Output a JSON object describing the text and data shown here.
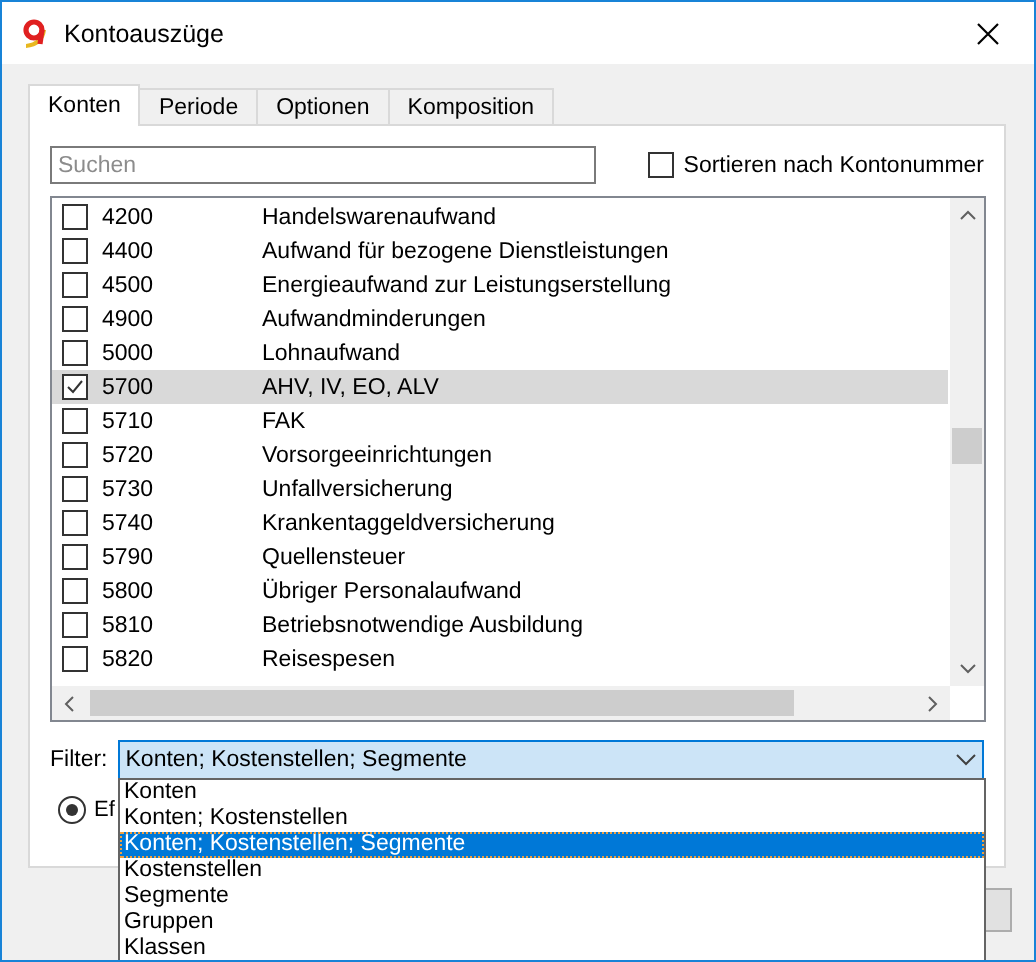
{
  "window": {
    "title": "Kontoauszüge"
  },
  "tabs": [
    {
      "label": "Konten",
      "selected": true
    },
    {
      "label": "Periode",
      "selected": false
    },
    {
      "label": "Optionen",
      "selected": false
    },
    {
      "label": "Komposition",
      "selected": false
    }
  ],
  "search": {
    "placeholder": "Suchen"
  },
  "sort_checkbox": {
    "label": "Sortieren nach Kontonummer",
    "checked": false
  },
  "accounts": [
    {
      "number": "4200",
      "name": "Handelswarenaufwand",
      "checked": false,
      "selected": false
    },
    {
      "number": "4400",
      "name": "Aufwand für bezogene Dienstleistungen",
      "checked": false,
      "selected": false
    },
    {
      "number": "4500",
      "name": "Energieaufwand zur Leistungserstellung",
      "checked": false,
      "selected": false
    },
    {
      "number": "4900",
      "name": "Aufwandminderungen",
      "checked": false,
      "selected": false
    },
    {
      "number": "5000",
      "name": "Lohnaufwand",
      "checked": false,
      "selected": false
    },
    {
      "number": "5700",
      "name": "AHV, IV, EO, ALV",
      "checked": true,
      "selected": true
    },
    {
      "number": "5710",
      "name": "FAK",
      "checked": false,
      "selected": false
    },
    {
      "number": "5720",
      "name": "Vorsorgeeinrichtungen",
      "checked": false,
      "selected": false
    },
    {
      "number": "5730",
      "name": "Unfallversicherung",
      "checked": false,
      "selected": false
    },
    {
      "number": "5740",
      "name": "Krankentaggeldversicherung",
      "checked": false,
      "selected": false
    },
    {
      "number": "5790",
      "name": "Quellensteuer",
      "checked": false,
      "selected": false
    },
    {
      "number": "5800",
      "name": "Übriger Personalaufwand",
      "checked": false,
      "selected": false
    },
    {
      "number": "5810",
      "name": "Betriebsnotwendige Ausbildung",
      "checked": false,
      "selected": false
    },
    {
      "number": "5820",
      "name": "Reisespesen",
      "checked": false,
      "selected": false
    }
  ],
  "filter": {
    "label": "Filter:",
    "value": "Konten; Kostenstellen; Segmente",
    "expanded": true,
    "options": [
      {
        "label": "Konten",
        "selected": false
      },
      {
        "label": "Konten; Kostenstellen",
        "selected": false
      },
      {
        "label": "Konten; Kostenstellen; Segmente",
        "selected": true
      },
      {
        "label": "Kostenstellen",
        "selected": false
      },
      {
        "label": "Segmente",
        "selected": false
      },
      {
        "label": "Gruppen",
        "selected": false
      },
      {
        "label": "Klassen",
        "selected": false
      }
    ]
  },
  "radio": {
    "label": "Ef",
    "selected": true
  }
}
